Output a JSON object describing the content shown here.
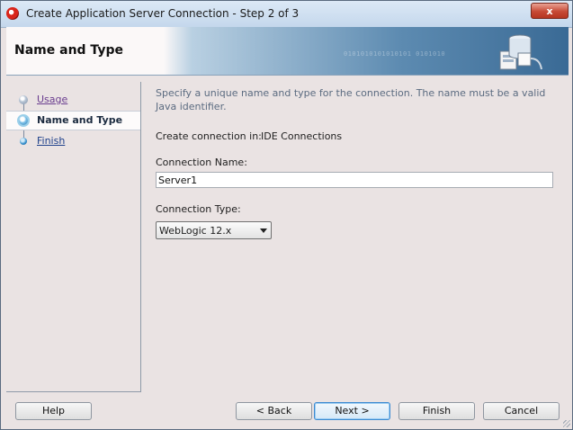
{
  "window": {
    "title": "Create Application Server Connection - Step 2 of 3",
    "close_label": "x"
  },
  "header": {
    "title": "Name and Type",
    "decoration_text": "0101010101010101 0101010"
  },
  "nav": {
    "items": [
      {
        "label": "Usage",
        "state": "visited"
      },
      {
        "label": "Name and Type",
        "state": "current"
      },
      {
        "label": "Finish",
        "state": "pending"
      }
    ]
  },
  "content": {
    "description": "Specify a unique name and type for the connection. The name must be a valid Java identifier.",
    "create_in_label": "Create connection in:",
    "create_in_value": "IDE Connections",
    "connection_name_label": "Connection Name:",
    "connection_name_value": "Server1",
    "connection_type_label": "Connection Type:",
    "connection_type_value": "WebLogic 12.x"
  },
  "buttons": {
    "help": "Help",
    "back": "< Back",
    "next": "Next >",
    "finish": "Finish",
    "cancel": "Cancel"
  },
  "colors": {
    "window_bg": "#eae3e3",
    "header_accent": "#3a6a95",
    "link_visited": "#6a3d8f",
    "link": "#1d3f8a",
    "default_button_border": "#3c8ad1"
  }
}
